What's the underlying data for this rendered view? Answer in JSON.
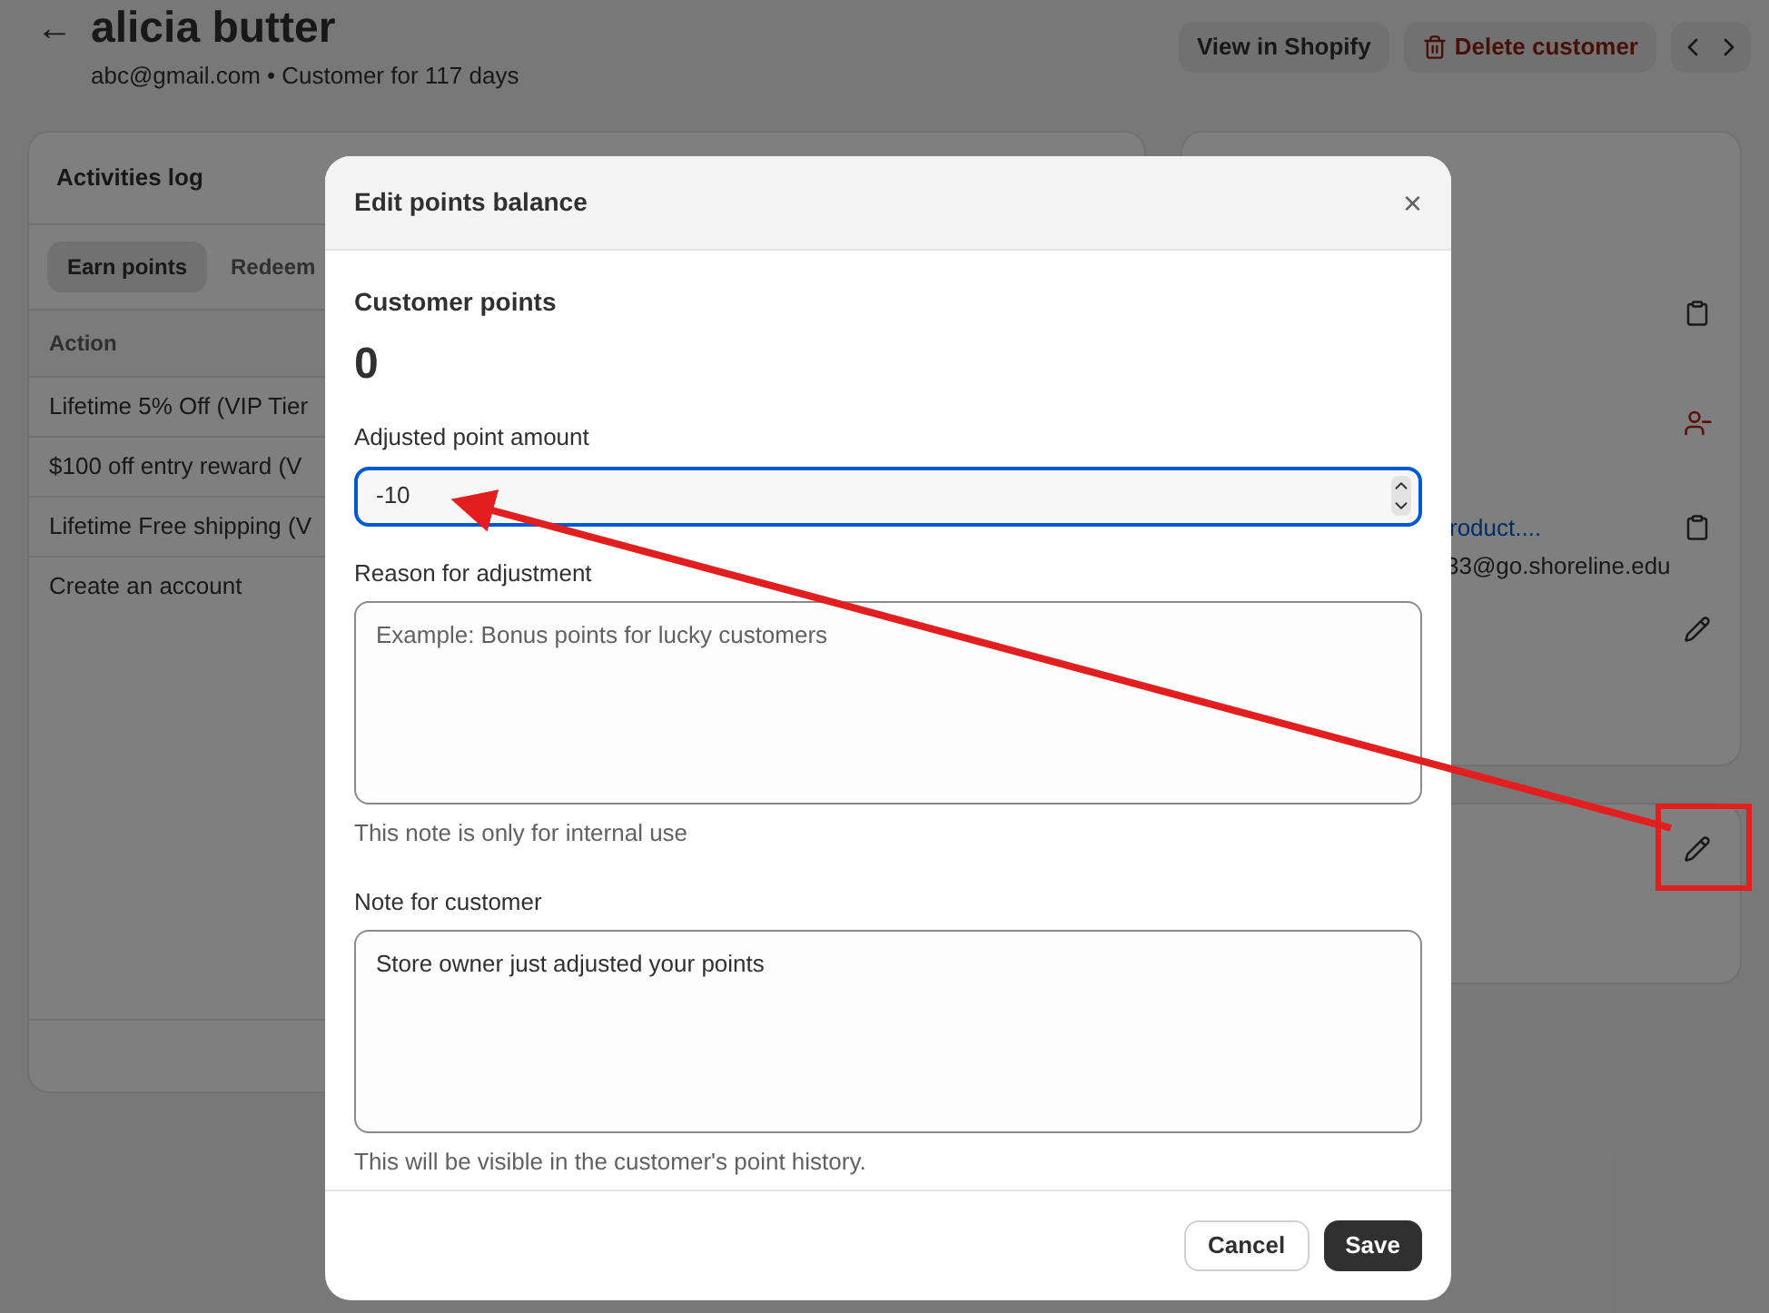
{
  "header": {
    "back": "←",
    "title": "alicia butter",
    "subtitle": "abc@gmail.com • Customer for 117 days",
    "buttons": [
      {
        "label": "View in Shopify",
        "kind": "plain"
      },
      {
        "label": "Delete customer",
        "kind": "danger"
      }
    ]
  },
  "activities": {
    "title": "Activities log",
    "tabs": [
      {
        "label": "Earn points",
        "selected": true
      },
      {
        "label": "Redeem",
        "selected": false
      }
    ],
    "column": "Action",
    "rows": [
      "Lifetime 5% Off (VIP Tier",
      "$100 off entry reward (V",
      "Lifetime Free shipping (V",
      "Create an account"
    ]
  },
  "side_card": {
    "link": "roduct....",
    "email": "33@go.shoreline.edu"
  },
  "dialog": {
    "title": "Edit points balance",
    "close": "×",
    "points_label": "Customer points",
    "points": "0",
    "amount_label": "Adjusted point amount",
    "amount": "-10",
    "reason_label": "Reason for adjustment",
    "reason_placeholder": "Example: Bonus points for lucky customers",
    "reason_help": "This note is only for internal use",
    "note_label": "Note for customer",
    "note": "Store owner just adjusted your points",
    "note_help": "This will be visible in the customer's point history.",
    "cancel": "Cancel",
    "save": "Save"
  }
}
